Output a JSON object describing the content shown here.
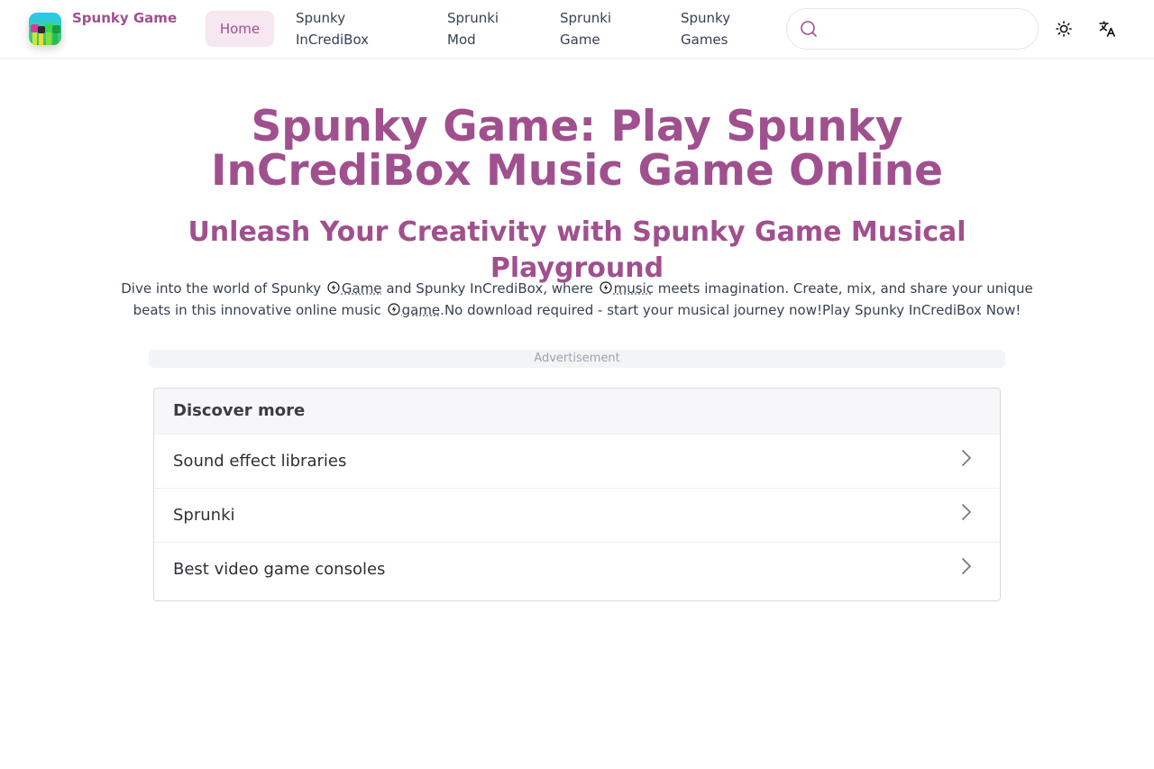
{
  "header": {
    "brand": "Spunky Game",
    "nav": [
      {
        "label": "Home"
      },
      {
        "label": "Spunky InCrediBox"
      },
      {
        "label": "Sprunki Mod"
      },
      {
        "label": "Sprunki Game"
      },
      {
        "label": "Spunky Games"
      }
    ],
    "search": {
      "placeholder": "",
      "value": ""
    },
    "icons": {
      "search": "search-icon",
      "theme": "sun-icon",
      "language": "translate-icon"
    },
    "accent_color": "#a0508e"
  },
  "main": {
    "title": "Spunky Game: Play Spunky InCrediBox Music Game Online",
    "subtitle": "Unleash Your Creativity with Spunky Game Musical Playground",
    "intro": {
      "p1": "Dive into the world of Spunky",
      "k1": "Game",
      "p2": "and Spunky InCrediBox, where",
      "k2": "music",
      "p3": "meets imagination. Create, mix, and share your unique beats in this innovative online music",
      "k3": "game",
      "p4": ".No download required - start your musical journey now!Play Spunky InCrediBox Now!"
    },
    "ad_label": "Advertisement",
    "discover": {
      "title": "Discover more",
      "items": [
        {
          "label": "Sound effect libraries"
        },
        {
          "label": "Sprunki"
        },
        {
          "label": "Best video game consoles"
        }
      ]
    }
  }
}
